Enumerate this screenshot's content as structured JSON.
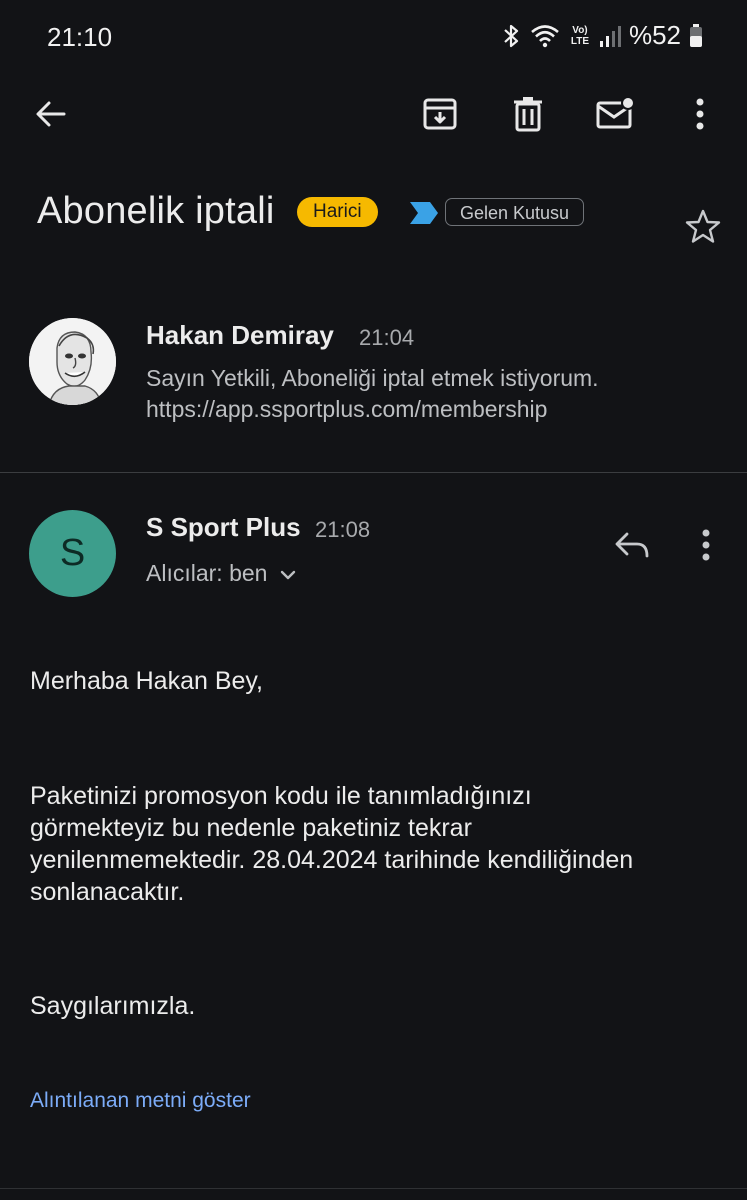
{
  "status_bar": {
    "time": "21:10",
    "network_label": "Vo) LTE",
    "battery": "%52",
    "icons": [
      "bluetooth-icon",
      "wifi-icon",
      "volte-lte-icon",
      "signal-icon",
      "battery-icon"
    ]
  },
  "toolbar": {
    "icons": [
      "back-arrow-icon",
      "archive-icon",
      "delete-icon",
      "mark-unread-icon",
      "more-vert-icon"
    ]
  },
  "subject": {
    "title": "Abonelik iptali",
    "label_external": "Harici",
    "label_inbox": "Gelen Kutusu",
    "colors": {
      "external_chip": "#f6b900",
      "importance_marker": "#3aa2e6"
    }
  },
  "messages": [
    {
      "sender": "Hakan Demiray",
      "time": "21:04",
      "snippet_line1": "Sayın Yetkili, Aboneliği iptal etmek istiyorum.",
      "snippet_line2": "https://app.ssportplus.com/membership"
    },
    {
      "sender": "S Sport Plus",
      "avatar_letter": "S",
      "avatar_color": "#3d9e8c",
      "time": "21:08",
      "recipients": "Alıcılar: ben",
      "greeting": "Merhaba Hakan Bey,",
      "body_lines": [
        "Paketinizi promosyon kodu ile tanımladığınızı",
        "görmekteyiz bu nedenle paketiniz tekrar",
        "yenilenmemektedir. 28.04.2024 tarihinde kendiliğinden",
        "sonlanacaktır."
      ],
      "closing": "Saygılarımızla.",
      "show_quoted": "Alıntılanan metni göster"
    }
  ]
}
